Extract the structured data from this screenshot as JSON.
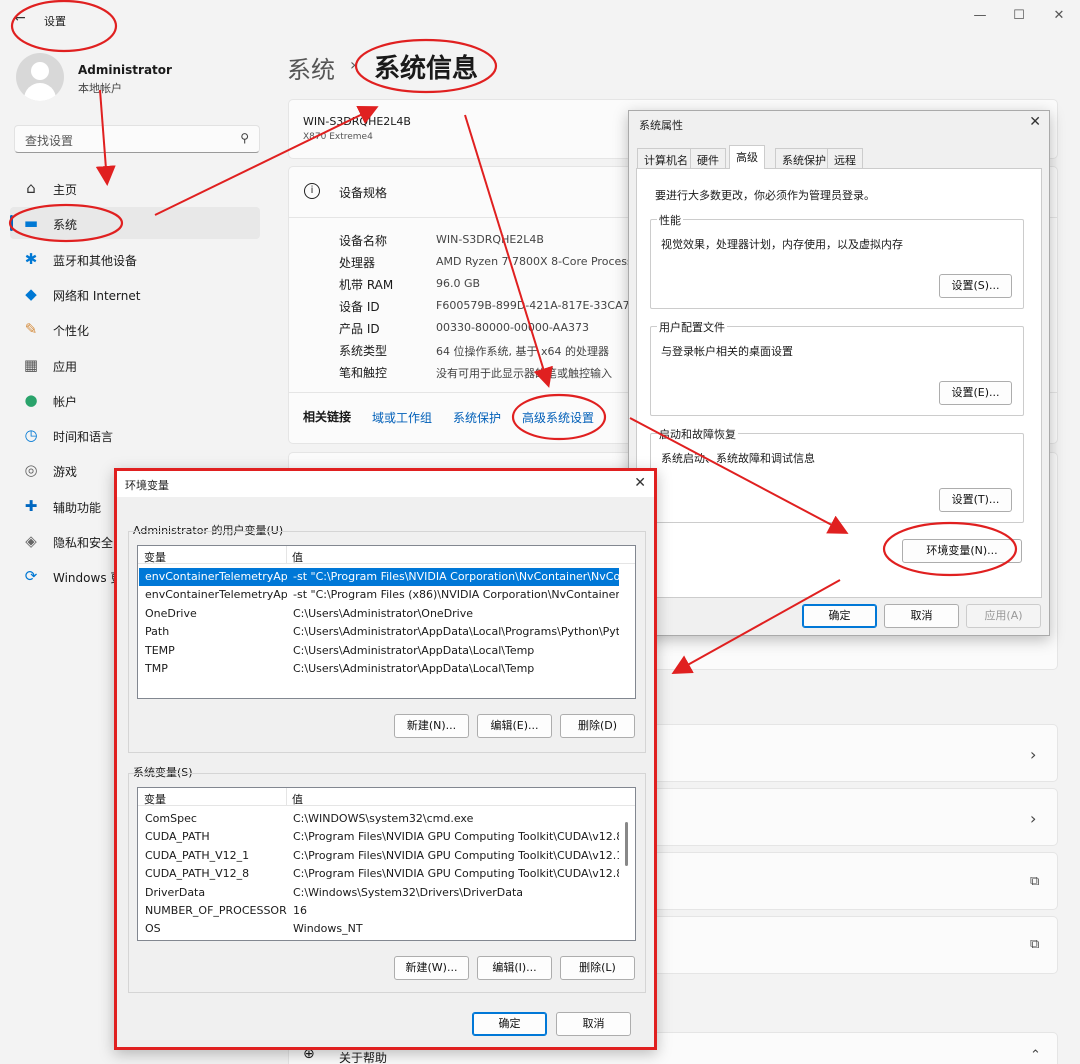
{
  "window": {
    "title": "设置",
    "minimize": "—",
    "maximize": "☐",
    "close": "✕"
  },
  "user": {
    "name": "Administrator",
    "account": "本地帐户"
  },
  "search": {
    "placeholder": "查找设置"
  },
  "nav": [
    {
      "label": "主页",
      "icon": "home-icon",
      "glyph": "⌂",
      "color": "#333"
    },
    {
      "label": "系统",
      "icon": "monitor-icon",
      "glyph": "▬",
      "color": "#0078d4"
    },
    {
      "label": "蓝牙和其他设备",
      "icon": "bluetooth-icon",
      "glyph": "✱",
      "color": "#0078d4"
    },
    {
      "label": "网络和 Internet",
      "icon": "wifi-icon",
      "glyph": "◆",
      "color": "#0078d4"
    },
    {
      "label": "个性化",
      "icon": "brush-icon",
      "glyph": "✎",
      "color": "#d48a3a"
    },
    {
      "label": "应用",
      "icon": "apps-icon",
      "glyph": "▦",
      "color": "#555"
    },
    {
      "label": "帐户",
      "icon": "account-icon",
      "glyph": "●",
      "color": "#2aa36b"
    },
    {
      "label": "时间和语言",
      "icon": "globe-clock-icon",
      "glyph": "◷",
      "color": "#0078d4"
    },
    {
      "label": "游戏",
      "icon": "gamepad-icon",
      "glyph": "◎",
      "color": "#666"
    },
    {
      "label": "辅助功能",
      "icon": "accessibility-icon",
      "glyph": "✚",
      "color": "#0067c0"
    },
    {
      "label": "隐私和安全",
      "icon": "shield-icon",
      "glyph": "◈",
      "color": "#666"
    },
    {
      "label": "Windows 更",
      "icon": "update-icon",
      "glyph": "⟳",
      "color": "#0078d4"
    }
  ],
  "breadcrumb": {
    "parent": "系统",
    "separator": "›",
    "current": "系统信息"
  },
  "device": {
    "name": "WIN-S3DRQHE2L4B",
    "model": "X870 Extreme4",
    "spec_title": "设备规格",
    "specs": [
      {
        "k": "设备名称",
        "v": "WIN-S3DRQHE2L4B"
      },
      {
        "k": "处理器",
        "v": "AMD Ryzen 7 7800X 8-Core Processor"
      },
      {
        "k": "机带 RAM",
        "v": "96.0 GB"
      },
      {
        "k": "设备 ID",
        "v": "F600579B-899D-421A-817E-33CA74"
      },
      {
        "k": "产品 ID",
        "v": "00330-80000-00000-AA373"
      },
      {
        "k": "系统类型",
        "v": "64 位操作系统, 基于 x64 的处理器"
      },
      {
        "k": "笔和触控",
        "v": "没有可用于此显示器的笔或触控输入"
      }
    ],
    "related_label": "相关链接",
    "related_links": [
      "域或工作组",
      "系统保护",
      "高级系统设置"
    ],
    "help": "关于帮助"
  },
  "sysprops": {
    "title": "系统属性",
    "tabs": [
      "计算机名",
      "硬件",
      "高级",
      "系统保护",
      "远程"
    ],
    "admin_note": "要进行大多数更改，你必须作为管理员登录。",
    "perf": {
      "title": "性能",
      "desc": "视觉效果，处理器计划，内存使用，以及虚拟内存",
      "button": "设置(S)..."
    },
    "profile": {
      "title": "用户配置文件",
      "desc": "与登录帐户相关的桌面设置",
      "button": "设置(E)..."
    },
    "startup": {
      "title": "启动和故障恢复",
      "desc": "系统启动、系统故障和调试信息",
      "button": "设置(T)..."
    },
    "env_button": "环境变量(N)...",
    "ok": "确定",
    "cancel": "取消",
    "apply": "应用(A)"
  },
  "envvars": {
    "title": "环境变量",
    "user_section": "Administrator 的用户变量(U)",
    "col_name": "变量",
    "col_value": "值",
    "user_vars": [
      {
        "name": "envContainerTelemetryAp...",
        "value": "-st \"C:\\Program Files\\NVIDIA Corporation\\NvContainer\\NvCo..."
      },
      {
        "name": "envContainerTelemetryAp...",
        "value": "-st \"C:\\Program Files (x86)\\NVIDIA Corporation\\NvContainer\\..."
      },
      {
        "name": "OneDrive",
        "value": "C:\\Users\\Administrator\\OneDrive"
      },
      {
        "name": "Path",
        "value": "C:\\Users\\Administrator\\AppData\\Local\\Programs\\Python\\Pyt..."
      },
      {
        "name": "TEMP",
        "value": "C:\\Users\\Administrator\\AppData\\Local\\Temp"
      },
      {
        "name": "TMP",
        "value": "C:\\Users\\Administrator\\AppData\\Local\\Temp"
      }
    ],
    "user_buttons": [
      "新建(N)...",
      "编辑(E)...",
      "删除(D)"
    ],
    "sys_section": "系统变量(S)",
    "sys_vars": [
      {
        "name": "ComSpec",
        "value": "C:\\WINDOWS\\system32\\cmd.exe"
      },
      {
        "name": "CUDA_PATH",
        "value": "C:\\Program Files\\NVIDIA GPU Computing Toolkit\\CUDA\\v12.8"
      },
      {
        "name": "CUDA_PATH_V12_1",
        "value": "C:\\Program Files\\NVIDIA GPU Computing Toolkit\\CUDA\\v12.1"
      },
      {
        "name": "CUDA_PATH_V12_8",
        "value": "C:\\Program Files\\NVIDIA GPU Computing Toolkit\\CUDA\\v12.8"
      },
      {
        "name": "DriverData",
        "value": "C:\\Windows\\System32\\Drivers\\DriverData"
      },
      {
        "name": "NUMBER_OF_PROCESSORS",
        "value": "16"
      },
      {
        "name": "OS",
        "value": "Windows_NT"
      }
    ],
    "sys_buttons": [
      "新建(W)...",
      "编辑(I)...",
      "删除(L)"
    ],
    "ok": "确定",
    "cancel": "取消"
  },
  "colors": {
    "accent": "#0067c0",
    "annotation": "#e02020",
    "selection": "#0078d7"
  }
}
